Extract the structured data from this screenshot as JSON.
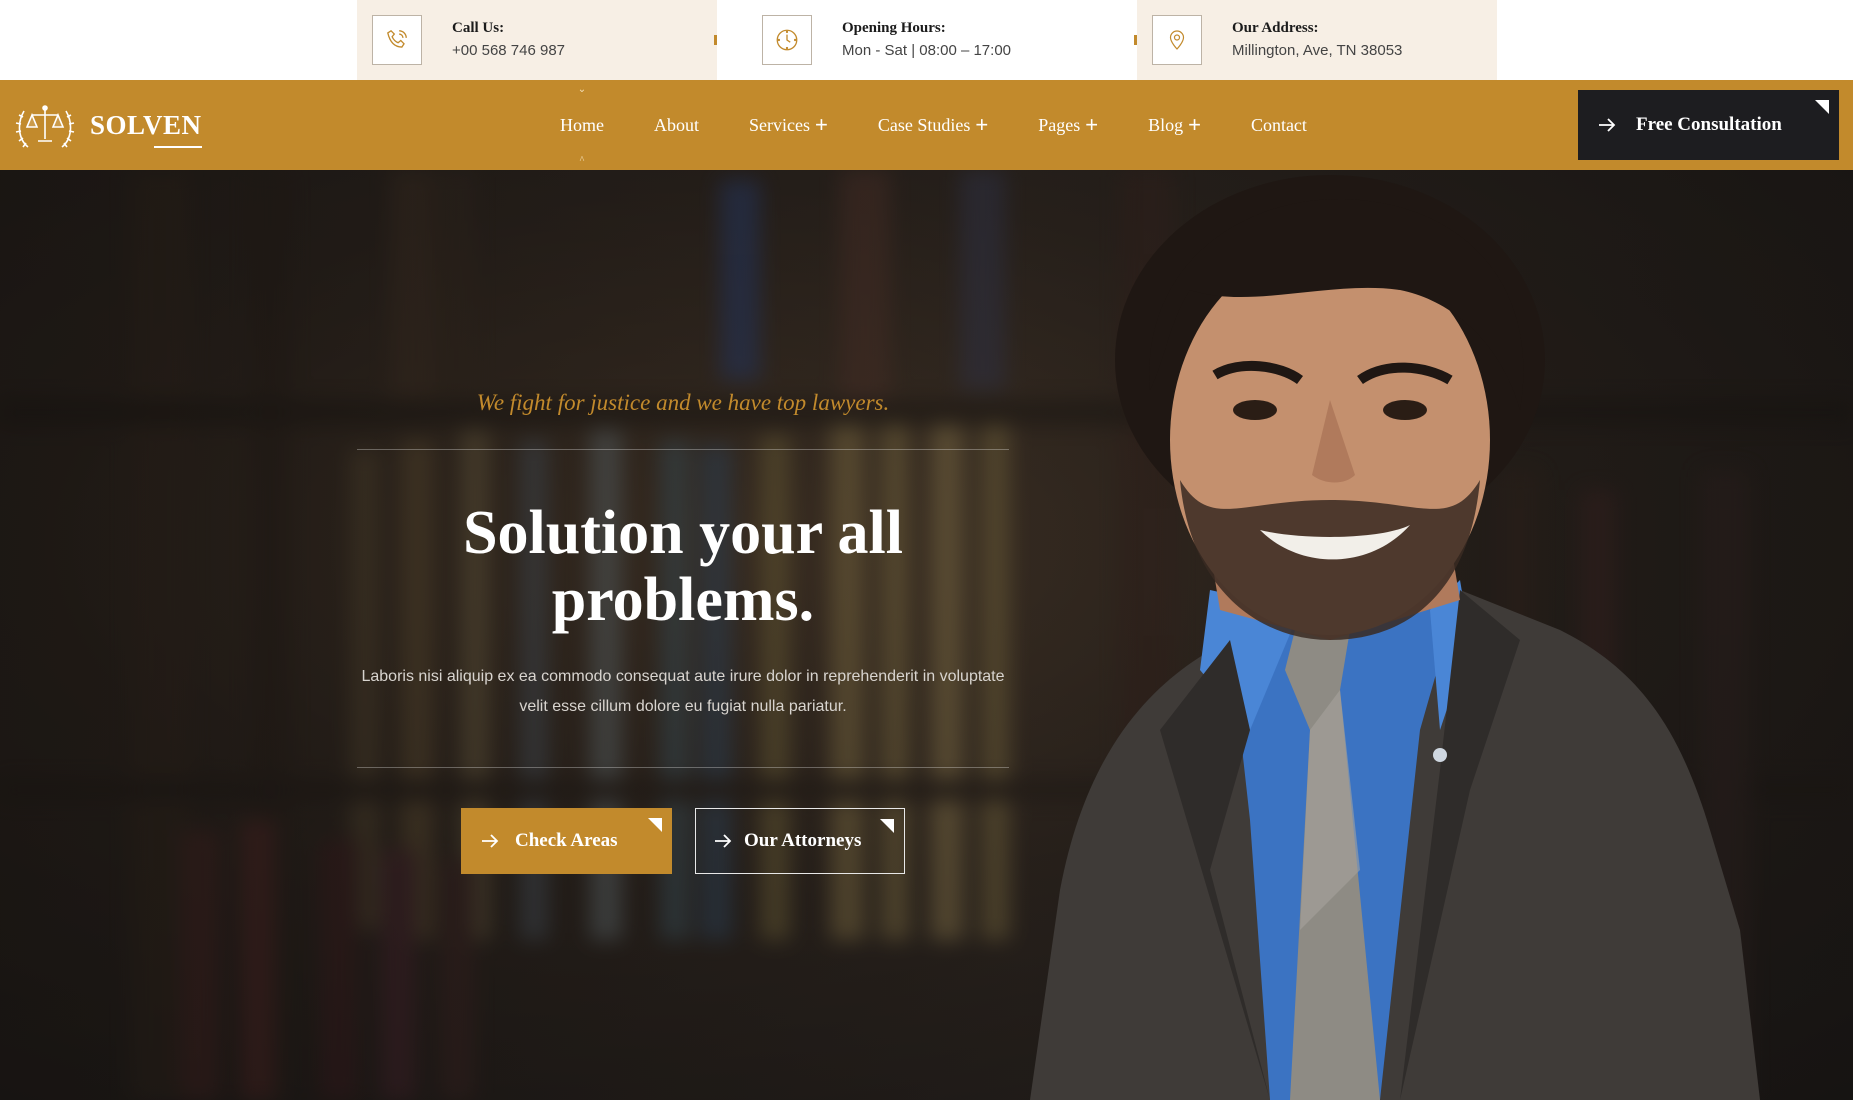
{
  "topbar": {
    "items": [
      {
        "label": "Call Us:",
        "value": "+00 568 746 987",
        "icon": "phone-icon"
      },
      {
        "label": "Opening Hours:",
        "value": "Mon - Sat | 08:00 – 17:00",
        "icon": "clock-icon"
      },
      {
        "label": "Our Address:",
        "value": "Millington, Ave, TN 38053",
        "icon": "location-pin-icon"
      }
    ]
  },
  "brand": {
    "name": "SOLVEN",
    "logo_icon": "scales-of-justice-icon"
  },
  "nav": {
    "items": [
      {
        "label": "Home",
        "active": true
      },
      {
        "label": "About"
      },
      {
        "label": "Services",
        "has_submenu": true
      },
      {
        "label": "Case Studies",
        "has_submenu": true
      },
      {
        "label": "Pages",
        "has_submenu": true
      },
      {
        "label": "Blog",
        "has_submenu": true
      },
      {
        "label": "Contact"
      }
    ],
    "plus": "+",
    "cta_label": "Free Consultation"
  },
  "hero": {
    "tagline": "We fight for justice and we have top lawyers.",
    "headline": "Solution your all problems.",
    "description": "Laboris nisi aliquip ex ea commodo consequat aute irure dolor in reprehenderit in voluptate velit esse cillum dolore eu fugiat nulla pariatur.",
    "primary_button": "Check Areas",
    "secondary_button": "Our Attorneys"
  },
  "colors": {
    "accent": "#c28a2c",
    "dark": "#1d1d20",
    "info_bg": "#f7efe5"
  }
}
